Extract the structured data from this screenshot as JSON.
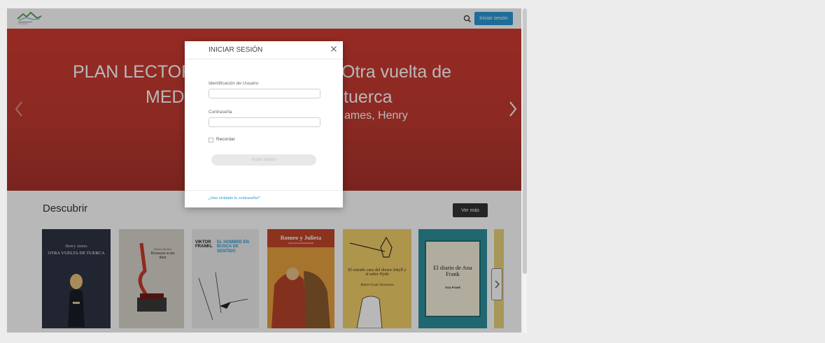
{
  "header": {
    "login_button": "Iniciar sesión",
    "search_icon": "search-icon",
    "logo_icon": "mountains-logo"
  },
  "hero": {
    "title_left_line1": "PLAN LECTOR",
    "title_left_line2": "MED",
    "title_right_line1": "Otra vuelta de",
    "title_right_line2": "tuerca",
    "author": "ames, Henry",
    "prev_icon": "chevron-left-icon",
    "next_icon": "chevron-right-icon"
  },
  "discover": {
    "title": "Descubrir",
    "see_more": "Ver más",
    "books": [
      {
        "title": "Otra Vuelta de Tuerca",
        "author": "Henry James",
        "color": "#2f3344"
      },
      {
        "title": "Rosaura a las diez",
        "author": "Marco Denevi",
        "color": "#d8d3cb"
      },
      {
        "title": "El hombre en busca de sentido",
        "author": "Viktor Frankl",
        "color": "#eeeeee"
      },
      {
        "title": "Romeo y Julieta",
        "author": "William Shakespeare",
        "color": "#e7a13f"
      },
      {
        "title": "El extraño caso del doctor Jekyll y el señor Hyde",
        "author": "Robert Louis Stevenson",
        "color": "#f1cf6a"
      },
      {
        "title": "El diario de Ana Frank",
        "author": "Ana Frank",
        "color": "#2f8f9c"
      }
    ],
    "book_texts": {
      "b1_author": "Henry James",
      "b1_title": "Otra Vuelta de Tuerca",
      "b2_author": "Marco Denevi",
      "b2_title": "Rosaura a las diez",
      "b3_author": "VIKTOR FRANKL",
      "b3_title": "EL HOMBRE EN BUSCA DE SENTIDO",
      "b4_title": "Romeo y Julieta",
      "b4_author": "WILLIAM SHAKESPEARE",
      "b5_title": "El extraño caso del doctor Jekyll y el señor Hyde",
      "b5_author": "Robert Louis Stevenson",
      "b6_title": "El diario de Ana Frank",
      "b6_author": "Ana Frank"
    },
    "next_icon": "chevron-right-icon"
  },
  "modal": {
    "title": "INICIAR SESIÓN",
    "close_icon": "close-icon",
    "user_label": "Identificación de Usuario",
    "user_value": "",
    "password_label": "Contraseña",
    "password_value": "",
    "remember_label": "Recordar",
    "submit_label": "Iniciar sesión",
    "forgot_link": "¿Has olvidado tu contraseña?"
  },
  "colors": {
    "hero_red": "#c23a31",
    "primary_blue": "#2a97d4",
    "dark_button": "#333333"
  }
}
